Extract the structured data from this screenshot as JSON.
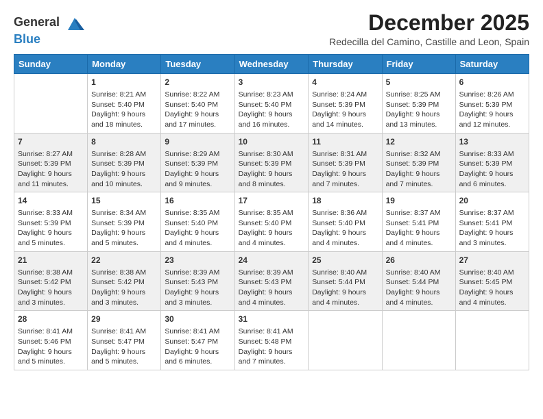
{
  "logo": {
    "general": "General",
    "blue": "Blue"
  },
  "title": "December 2025",
  "subtitle": "Redecilla del Camino, Castille and Leon, Spain",
  "days_of_week": [
    "Sunday",
    "Monday",
    "Tuesday",
    "Wednesday",
    "Thursday",
    "Friday",
    "Saturday"
  ],
  "weeks": [
    [
      {
        "day": "",
        "sunrise": "",
        "sunset": "",
        "daylight": ""
      },
      {
        "day": "1",
        "sunrise": "Sunrise: 8:21 AM",
        "sunset": "Sunset: 5:40 PM",
        "daylight": "Daylight: 9 hours and 18 minutes."
      },
      {
        "day": "2",
        "sunrise": "Sunrise: 8:22 AM",
        "sunset": "Sunset: 5:40 PM",
        "daylight": "Daylight: 9 hours and 17 minutes."
      },
      {
        "day": "3",
        "sunrise": "Sunrise: 8:23 AM",
        "sunset": "Sunset: 5:40 PM",
        "daylight": "Daylight: 9 hours and 16 minutes."
      },
      {
        "day": "4",
        "sunrise": "Sunrise: 8:24 AM",
        "sunset": "Sunset: 5:39 PM",
        "daylight": "Daylight: 9 hours and 14 minutes."
      },
      {
        "day": "5",
        "sunrise": "Sunrise: 8:25 AM",
        "sunset": "Sunset: 5:39 PM",
        "daylight": "Daylight: 9 hours and 13 minutes."
      },
      {
        "day": "6",
        "sunrise": "Sunrise: 8:26 AM",
        "sunset": "Sunset: 5:39 PM",
        "daylight": "Daylight: 9 hours and 12 minutes."
      }
    ],
    [
      {
        "day": "7",
        "sunrise": "Sunrise: 8:27 AM",
        "sunset": "Sunset: 5:39 PM",
        "daylight": "Daylight: 9 hours and 11 minutes."
      },
      {
        "day": "8",
        "sunrise": "Sunrise: 8:28 AM",
        "sunset": "Sunset: 5:39 PM",
        "daylight": "Daylight: 9 hours and 10 minutes."
      },
      {
        "day": "9",
        "sunrise": "Sunrise: 8:29 AM",
        "sunset": "Sunset: 5:39 PM",
        "daylight": "Daylight: 9 hours and 9 minutes."
      },
      {
        "day": "10",
        "sunrise": "Sunrise: 8:30 AM",
        "sunset": "Sunset: 5:39 PM",
        "daylight": "Daylight: 9 hours and 8 minutes."
      },
      {
        "day": "11",
        "sunrise": "Sunrise: 8:31 AM",
        "sunset": "Sunset: 5:39 PM",
        "daylight": "Daylight: 9 hours and 7 minutes."
      },
      {
        "day": "12",
        "sunrise": "Sunrise: 8:32 AM",
        "sunset": "Sunset: 5:39 PM",
        "daylight": "Daylight: 9 hours and 7 minutes."
      },
      {
        "day": "13",
        "sunrise": "Sunrise: 8:33 AM",
        "sunset": "Sunset: 5:39 PM",
        "daylight": "Daylight: 9 hours and 6 minutes."
      }
    ],
    [
      {
        "day": "14",
        "sunrise": "Sunrise: 8:33 AM",
        "sunset": "Sunset: 5:39 PM",
        "daylight": "Daylight: 9 hours and 5 minutes."
      },
      {
        "day": "15",
        "sunrise": "Sunrise: 8:34 AM",
        "sunset": "Sunset: 5:39 PM",
        "daylight": "Daylight: 9 hours and 5 minutes."
      },
      {
        "day": "16",
        "sunrise": "Sunrise: 8:35 AM",
        "sunset": "Sunset: 5:40 PM",
        "daylight": "Daylight: 9 hours and 4 minutes."
      },
      {
        "day": "17",
        "sunrise": "Sunrise: 8:35 AM",
        "sunset": "Sunset: 5:40 PM",
        "daylight": "Daylight: 9 hours and 4 minutes."
      },
      {
        "day": "18",
        "sunrise": "Sunrise: 8:36 AM",
        "sunset": "Sunset: 5:40 PM",
        "daylight": "Daylight: 9 hours and 4 minutes."
      },
      {
        "day": "19",
        "sunrise": "Sunrise: 8:37 AM",
        "sunset": "Sunset: 5:41 PM",
        "daylight": "Daylight: 9 hours and 4 minutes."
      },
      {
        "day": "20",
        "sunrise": "Sunrise: 8:37 AM",
        "sunset": "Sunset: 5:41 PM",
        "daylight": "Daylight: 9 hours and 3 minutes."
      }
    ],
    [
      {
        "day": "21",
        "sunrise": "Sunrise: 8:38 AM",
        "sunset": "Sunset: 5:42 PM",
        "daylight": "Daylight: 9 hours and 3 minutes."
      },
      {
        "day": "22",
        "sunrise": "Sunrise: 8:38 AM",
        "sunset": "Sunset: 5:42 PM",
        "daylight": "Daylight: 9 hours and 3 minutes."
      },
      {
        "day": "23",
        "sunrise": "Sunrise: 8:39 AM",
        "sunset": "Sunset: 5:43 PM",
        "daylight": "Daylight: 9 hours and 3 minutes."
      },
      {
        "day": "24",
        "sunrise": "Sunrise: 8:39 AM",
        "sunset": "Sunset: 5:43 PM",
        "daylight": "Daylight: 9 hours and 4 minutes."
      },
      {
        "day": "25",
        "sunrise": "Sunrise: 8:40 AM",
        "sunset": "Sunset: 5:44 PM",
        "daylight": "Daylight: 9 hours and 4 minutes."
      },
      {
        "day": "26",
        "sunrise": "Sunrise: 8:40 AM",
        "sunset": "Sunset: 5:44 PM",
        "daylight": "Daylight: 9 hours and 4 minutes."
      },
      {
        "day": "27",
        "sunrise": "Sunrise: 8:40 AM",
        "sunset": "Sunset: 5:45 PM",
        "daylight": "Daylight: 9 hours and 4 minutes."
      }
    ],
    [
      {
        "day": "28",
        "sunrise": "Sunrise: 8:41 AM",
        "sunset": "Sunset: 5:46 PM",
        "daylight": "Daylight: 9 hours and 5 minutes."
      },
      {
        "day": "29",
        "sunrise": "Sunrise: 8:41 AM",
        "sunset": "Sunset: 5:47 PM",
        "daylight": "Daylight: 9 hours and 5 minutes."
      },
      {
        "day": "30",
        "sunrise": "Sunrise: 8:41 AM",
        "sunset": "Sunset: 5:47 PM",
        "daylight": "Daylight: 9 hours and 6 minutes."
      },
      {
        "day": "31",
        "sunrise": "Sunrise: 8:41 AM",
        "sunset": "Sunset: 5:48 PM",
        "daylight": "Daylight: 9 hours and 7 minutes."
      },
      {
        "day": "",
        "sunrise": "",
        "sunset": "",
        "daylight": ""
      },
      {
        "day": "",
        "sunrise": "",
        "sunset": "",
        "daylight": ""
      },
      {
        "day": "",
        "sunrise": "",
        "sunset": "",
        "daylight": ""
      }
    ]
  ]
}
